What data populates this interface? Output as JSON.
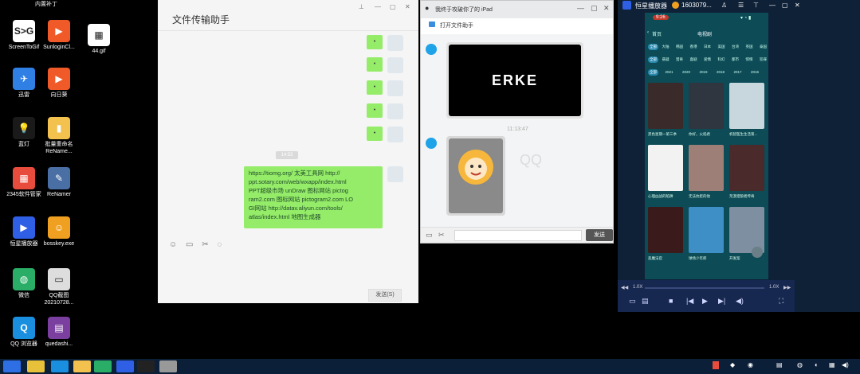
{
  "desktop": {
    "top_cut_label": "内置补丁",
    "icons": [
      {
        "label": "ScreenToGif",
        "icon": "screentogif-icon",
        "color": "#ffffff",
        "glyph": "S>G"
      },
      {
        "label": "SunloginCl...",
        "icon": "sunlogin-icon",
        "color": "#f05a28",
        "glyph": "▶"
      },
      {
        "label": "44.gif",
        "icon": "gif-file-icon",
        "color": "#ffffff",
        "glyph": "▦"
      },
      {
        "label": "迅雷",
        "icon": "xunlei-icon",
        "color": "#2f7fe5",
        "glyph": "✈"
      },
      {
        "label": "向日葵",
        "icon": "sunflower-icon",
        "color": "#f05a28",
        "glyph": "▶"
      },
      {
        "label": "蓝灯",
        "icon": "lantern-icon",
        "color": "#1a1a1a",
        "glyph": "💡"
      },
      {
        "label": "批量重命名ReName...",
        "icon": "folder-icon",
        "color": "#f2c14e",
        "glyph": "▮"
      },
      {
        "label": "2345软件管家",
        "icon": "software-manager-icon",
        "color": "#e84c3d",
        "glyph": "▦"
      },
      {
        "label": "ReNamer",
        "icon": "renamer-icon",
        "color": "#4a6fa5",
        "glyph": "✎"
      },
      {
        "label": "恒星播放器",
        "icon": "hengxing-player-icon",
        "color": "#2f5fe5",
        "glyph": "▶"
      },
      {
        "label": "bosskey.exe",
        "icon": "bosskey-icon",
        "color": "#f0a020",
        "glyph": "☺"
      },
      {
        "label": "微信",
        "icon": "wechat-icon",
        "color": "#2aae67",
        "glyph": "◍"
      },
      {
        "label": "QQ截图20210728...",
        "icon": "screenshot-file-icon",
        "color": "#dddddd",
        "glyph": "▭"
      },
      {
        "label": "QQ 浏览器",
        "icon": "qq-browser-icon",
        "color": "#1a8fe0",
        "glyph": "Q"
      },
      {
        "label": "quedashi...",
        "icon": "archive-icon",
        "color": "#7b3fa0",
        "glyph": "▤"
      }
    ]
  },
  "wechat": {
    "title": "文件传输助手",
    "small_msg_text": "•",
    "time_badge": "14:53",
    "big_msg_lines": [
      "https://tiomg.org/ 太美工具网 http://",
      "ppt.sotary.com/web/wxapp/index.html",
      "PPT超级市场 unDraw 图标网站 pictog",
      "ram2.com 图标网站 pictogram2.com LO",
      "GI网站 http://datav.aliyun.com/tools/",
      "atlas/index.html 地图生成器"
    ],
    "send_label": "发送(S)"
  },
  "qq": {
    "title": "我终于攻破你了的 iPad",
    "subheader": "打开文件助手",
    "erke_logo_text": "ERKE",
    "time": "11:13:47",
    "watermark": "QQ",
    "send_label": "发送"
  },
  "player": {
    "app_title": "恒星播放器",
    "user": "1603079...",
    "phone_time": "9:26",
    "nav_back": "首页",
    "nav_title": "电视剧",
    "filter_row1": [
      "全部",
      "大陆",
      "韩国",
      "香港",
      "日本",
      "美国",
      "台湾",
      "英国",
      "泰国"
    ],
    "filter_row2": [
      "全部",
      "悬疑",
      "猎奇",
      "喜剧",
      "爱情",
      "科幻",
      "都市",
      "惊悚",
      "犯罪"
    ],
    "filter_row3": [
      "全部",
      "2021",
      "2020",
      "2019",
      "2018",
      "2017",
      "2016"
    ],
    "posters": [
      {
        "title": "黑色星期一第三季",
        "color": "#3a2a2a"
      },
      {
        "title": "你好，火焰君",
        "color": "#2f3640"
      },
      {
        "title": "机智医生生活第...",
        "color": "#c8d6de"
      },
      {
        "title": "心理凶战的陷阱",
        "color": "#f2f2f2"
      },
      {
        "title": "无法抗拒的他",
        "color": "#9e7f78"
      },
      {
        "title": "荒漠猎狼者传奇",
        "color": "#4a2a2a"
      },
      {
        "title": "恶魔法官",
        "color": "#3a1a1a"
      },
      {
        "title": "球场少年郎",
        "color": "#3f8fc7"
      },
      {
        "title": "开发案",
        "color": "#7d8fa0"
      }
    ],
    "speed_left": "1.0X",
    "speed_right": "1.0X"
  },
  "taskbar": {
    "apps": [
      {
        "icon": "windows-start-icon",
        "color": "#2f6fe5"
      },
      {
        "icon": "chrome-icon",
        "color": "#e8c13a"
      },
      {
        "icon": "qq-chat-icon",
        "color": "#1a8fe0"
      },
      {
        "icon": "folder-explorer-icon",
        "color": "#f2c14e"
      },
      {
        "icon": "wechat-taskbar-icon",
        "color": "#2aae67"
      },
      {
        "icon": "hengxing-taskbar-icon",
        "color": "#2f5fe5"
      },
      {
        "icon": "qq-penguin-icon",
        "color": "#222222"
      },
      {
        "icon": "screen-capture-icon",
        "color": "#999999"
      }
    ]
  }
}
